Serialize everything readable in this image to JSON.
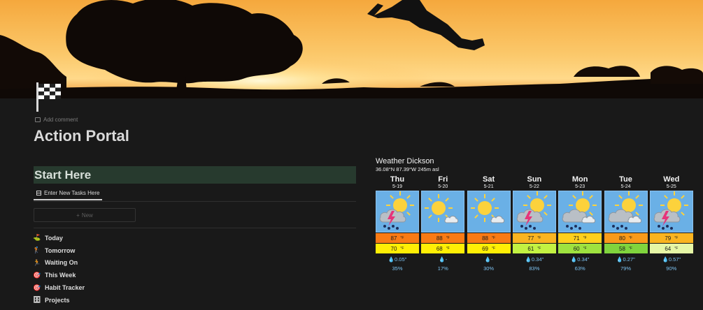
{
  "cover_icon": "sunset-jumping-person-cover-image",
  "page": {
    "icon": "checkered-flag-icon",
    "add_comment": "Add comment",
    "title": "Action Portal"
  },
  "section": {
    "heading": "Start Here",
    "tab_label": "Enter New Tasks Here",
    "new_button": "New"
  },
  "nav": [
    {
      "emoji": "⛳",
      "label": "Today"
    },
    {
      "emoji": "🏌",
      "label": "Tomorrow"
    },
    {
      "emoji": "🏃",
      "label": "Waiting On"
    },
    {
      "emoji": "🎯",
      "label": "This Week"
    },
    {
      "emoji": "🎯",
      "label": "Habit Tracker"
    },
    {
      "emoji": "🗄",
      "label": "Projects"
    }
  ],
  "weather": {
    "title": "Weather Dickson",
    "coords": "36.08°N 87.39°W 245m asl",
    "days": [
      {
        "name": "Thu",
        "date": "5-19",
        "icon": "thunderstorm-icon",
        "high": "87",
        "high_color": "#f97a14",
        "low": "70",
        "low_color": "#ffee05",
        "precip": "0.05\"",
        "prob": "35%"
      },
      {
        "name": "Fri",
        "date": "5-20",
        "icon": "partly-sunny-icon",
        "high": "88",
        "high_color": "#f97a14",
        "low": "68",
        "low_color": "#ffee05",
        "precip": "-",
        "prob": "17%"
      },
      {
        "name": "Sat",
        "date": "5-21",
        "icon": "partly-sunny-icon",
        "high": "88",
        "high_color": "#f97a14",
        "low": "69",
        "low_color": "#ffee05",
        "precip": "-",
        "prob": "30%"
      },
      {
        "name": "Sun",
        "date": "5-22",
        "icon": "thunderstorm-icon",
        "high": "77",
        "high_color": "#fab420",
        "low": "61",
        "low_color": "#c3f242",
        "precip": "0.34\"",
        "prob": "83%"
      },
      {
        "name": "Mon",
        "date": "5-23",
        "icon": "sun-cloud-rain-icon",
        "high": "71",
        "high_color": "#ffcf1c",
        "low": "60",
        "low_color": "#9ee23f",
        "precip": "0.34\"",
        "prob": "63%"
      },
      {
        "name": "Tue",
        "date": "5-24",
        "icon": "sun-cloud-rain-icon",
        "high": "80",
        "high_color": "#f99a1a",
        "low": "58",
        "low_color": "#80d43d",
        "precip": "0.27\"",
        "prob": "79%"
      },
      {
        "name": "Wed",
        "date": "5-25",
        "icon": "thunderstorm-icon",
        "high": "79",
        "high_color": "#fab420",
        "low": "64",
        "low_color": "#e6f7a6",
        "precip": "0.57\"",
        "prob": "90%"
      }
    ],
    "degree_unit": "°F"
  }
}
